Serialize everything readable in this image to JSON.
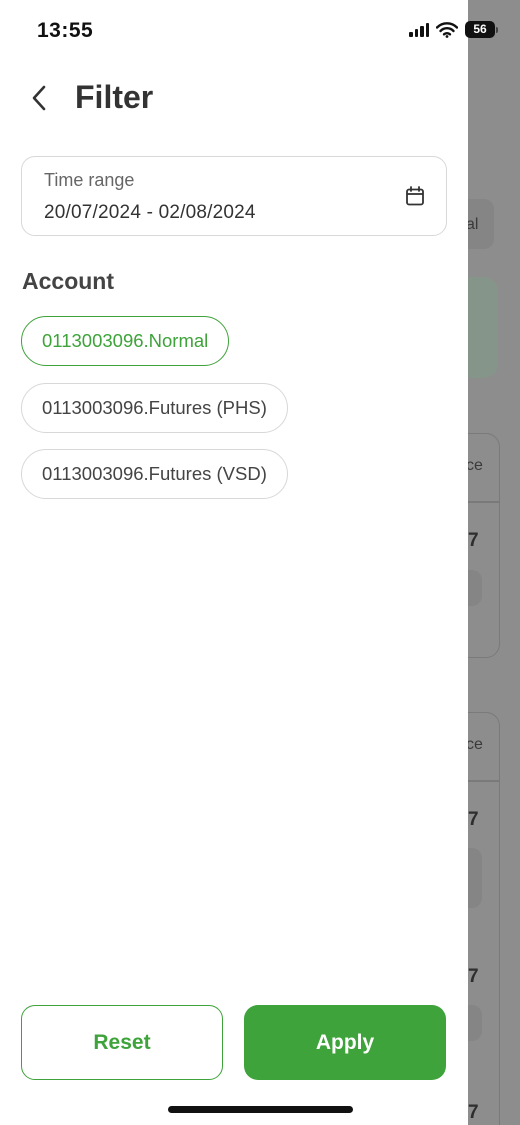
{
  "status_bar": {
    "time": "13:55",
    "battery": "56"
  },
  "header": {
    "title": "Filter"
  },
  "time_range": {
    "label": "Time range",
    "value": "20/07/2024 - 02/08/2024"
  },
  "account": {
    "title": "Account",
    "options": [
      {
        "label": "0113003096.Normal",
        "selected": true
      },
      {
        "label": "0113003096.Futures (PHS)",
        "selected": false
      },
      {
        "label": "0113003096.Futures (VSD)",
        "selected": false
      }
    ]
  },
  "actions": {
    "reset_label": "Reset",
    "apply_label": "Apply"
  },
  "background": {
    "fragments": [
      "al",
      "ce",
      "7",
      "ce",
      "7",
      "7",
      "7"
    ]
  },
  "colors": {
    "accent": "#3ea33a",
    "overlay": "#8d8d8d"
  }
}
